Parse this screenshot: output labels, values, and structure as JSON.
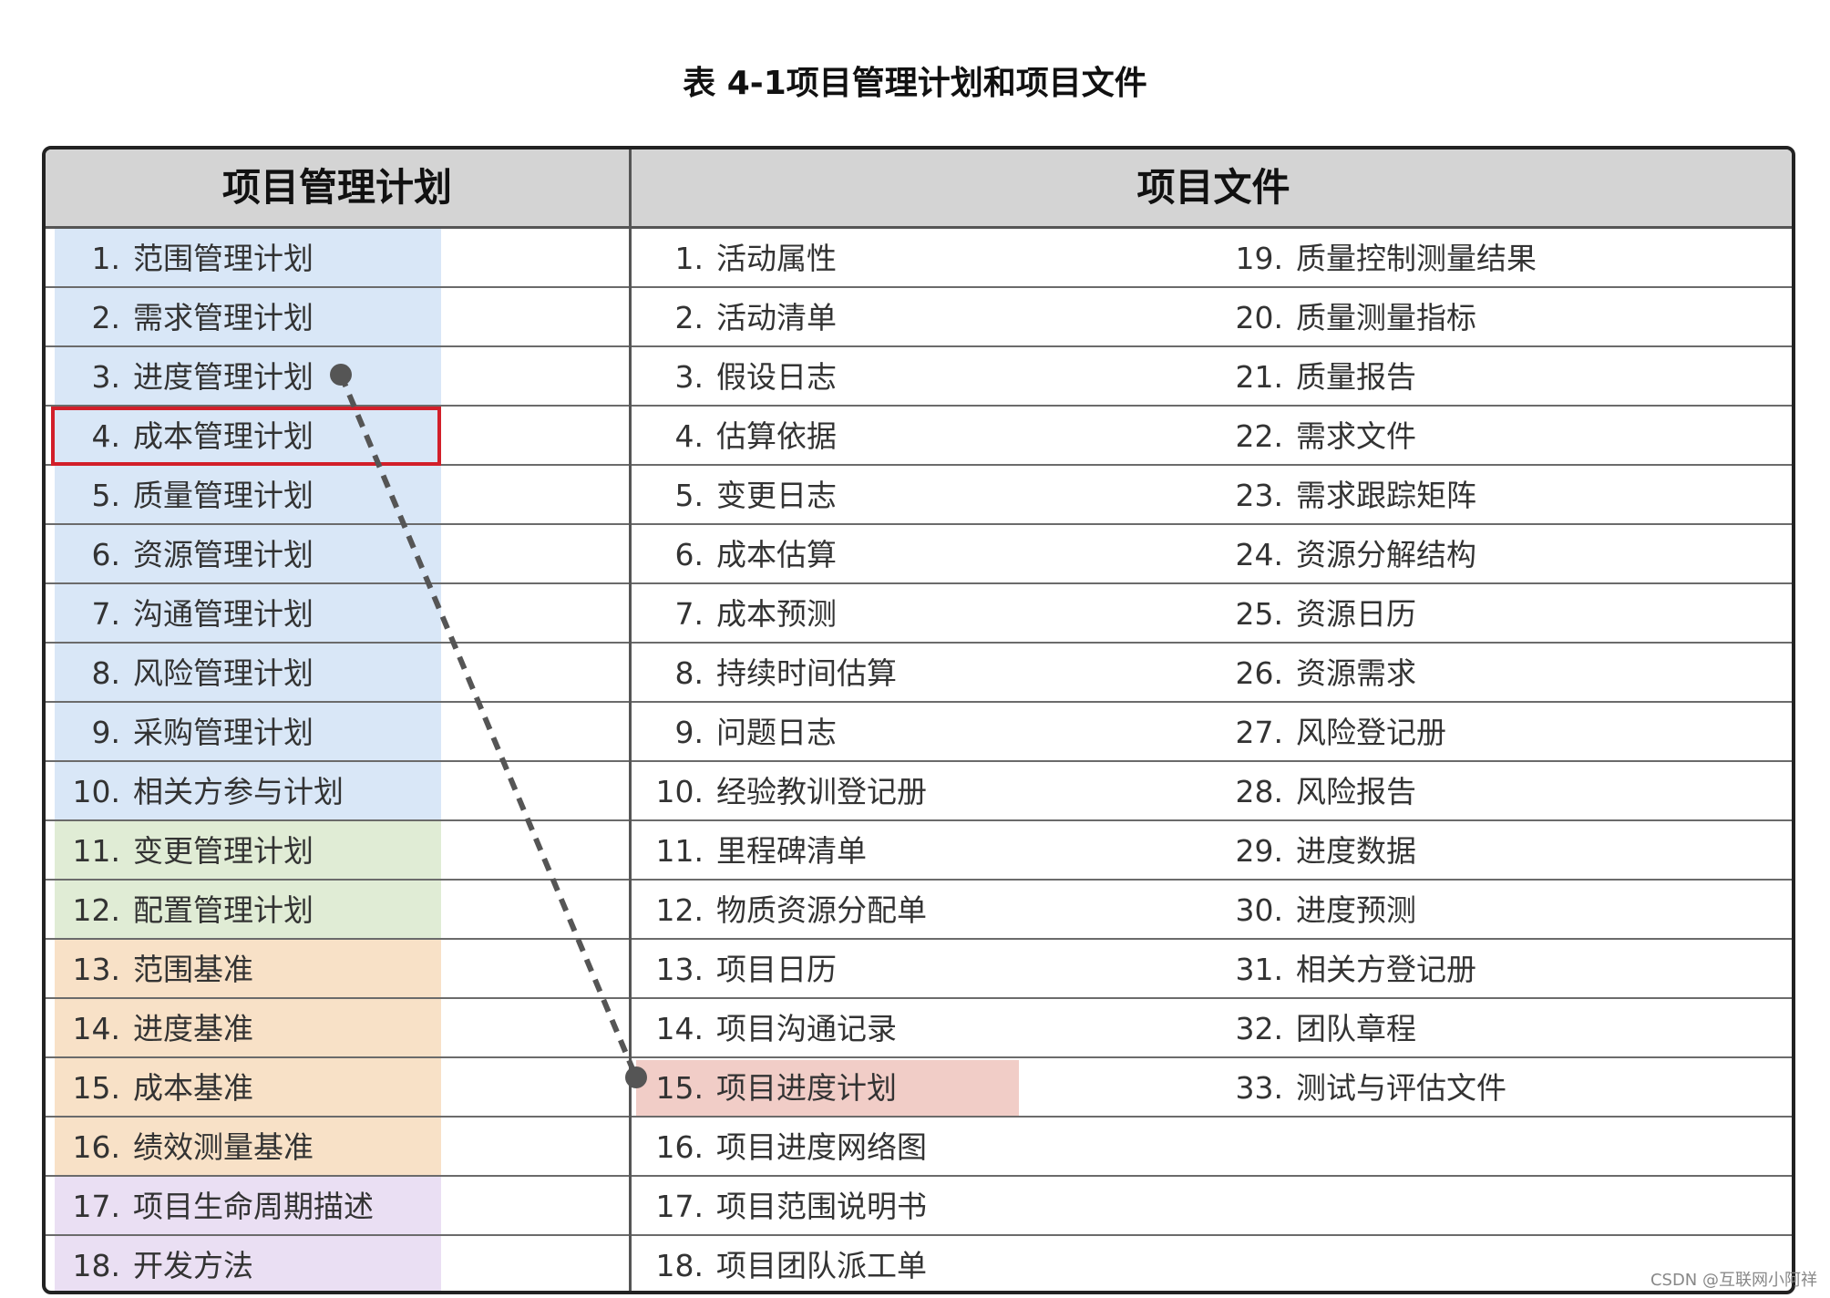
{
  "title": "表 4-1项目管理计划和项目文件",
  "headers": {
    "plan": "项目管理计划",
    "docs": "项目文件"
  },
  "colors": {
    "blue": "#d9e7f7",
    "green": "#e0ecd5",
    "orange": "#f8e1c7",
    "purple": "#eadff3",
    "red_border": "#d21f2a",
    "pink_highlight": "#f1cdc7"
  },
  "rows": [
    {
      "plan": {
        "num": "1.",
        "text": "范围管理计划"
      },
      "doc1": {
        "num": "1.",
        "text": "活动属性"
      },
      "doc2": {
        "num": "19.",
        "text": "质量控制测量结果"
      }
    },
    {
      "plan": {
        "num": "2.",
        "text": "需求管理计划"
      },
      "doc1": {
        "num": "2.",
        "text": "活动清单"
      },
      "doc2": {
        "num": "20.",
        "text": "质量测量指标"
      }
    },
    {
      "plan": {
        "num": "3.",
        "text": "进度管理计划"
      },
      "doc1": {
        "num": "3.",
        "text": "假设日志"
      },
      "doc2": {
        "num": "21.",
        "text": "质量报告"
      }
    },
    {
      "plan": {
        "num": "4.",
        "text": "成本管理计划"
      },
      "doc1": {
        "num": "4.",
        "text": "估算依据"
      },
      "doc2": {
        "num": "22.",
        "text": "需求文件"
      }
    },
    {
      "plan": {
        "num": "5.",
        "text": "质量管理计划"
      },
      "doc1": {
        "num": "5.",
        "text": "变更日志"
      },
      "doc2": {
        "num": "23.",
        "text": "需求跟踪矩阵"
      }
    },
    {
      "plan": {
        "num": "6.",
        "text": "资源管理计划"
      },
      "doc1": {
        "num": "6.",
        "text": "成本估算"
      },
      "doc2": {
        "num": "24.",
        "text": "资源分解结构"
      }
    },
    {
      "plan": {
        "num": "7.",
        "text": "沟通管理计划"
      },
      "doc1": {
        "num": "7.",
        "text": "成本预测"
      },
      "doc2": {
        "num": "25.",
        "text": "资源日历"
      }
    },
    {
      "plan": {
        "num": "8.",
        "text": "风险管理计划"
      },
      "doc1": {
        "num": "8.",
        "text": "持续时间估算"
      },
      "doc2": {
        "num": "26.",
        "text": "资源需求"
      }
    },
    {
      "plan": {
        "num": "9.",
        "text": "采购管理计划"
      },
      "doc1": {
        "num": "9.",
        "text": "问题日志"
      },
      "doc2": {
        "num": "27.",
        "text": "风险登记册"
      }
    },
    {
      "plan": {
        "num": "10.",
        "text": "相关方参与计划"
      },
      "doc1": {
        "num": "10.",
        "text": "经验教训登记册"
      },
      "doc2": {
        "num": "28.",
        "text": "风险报告"
      }
    },
    {
      "plan": {
        "num": "11.",
        "text": "变更管理计划"
      },
      "doc1": {
        "num": "11.",
        "text": "里程碑清单"
      },
      "doc2": {
        "num": "29.",
        "text": "进度数据"
      }
    },
    {
      "plan": {
        "num": "12.",
        "text": "配置管理计划"
      },
      "doc1": {
        "num": "12.",
        "text": "物质资源分配单"
      },
      "doc2": {
        "num": "30.",
        "text": "进度预测"
      }
    },
    {
      "plan": {
        "num": "13.",
        "text": "范围基准"
      },
      "doc1": {
        "num": "13.",
        "text": "项目日历"
      },
      "doc2": {
        "num": "31.",
        "text": "相关方登记册"
      }
    },
    {
      "plan": {
        "num": "14.",
        "text": "进度基准"
      },
      "doc1": {
        "num": "14.",
        "text": "项目沟通记录"
      },
      "doc2": {
        "num": "32.",
        "text": "团队章程"
      }
    },
    {
      "plan": {
        "num": "15.",
        "text": "成本基准"
      },
      "doc1": {
        "num": "15.",
        "text": "项目进度计划"
      },
      "doc2": {
        "num": "33.",
        "text": "测试与评估文件"
      }
    },
    {
      "plan": {
        "num": "16.",
        "text": "绩效测量基准"
      },
      "doc1": {
        "num": "16.",
        "text": "项目进度网络图"
      },
      "doc2": {
        "num": "",
        "text": ""
      }
    },
    {
      "plan": {
        "num": "17.",
        "text": "项目生命周期描述"
      },
      "doc1": {
        "num": "17.",
        "text": "项目范围说明书"
      },
      "doc2": {
        "num": "",
        "text": ""
      }
    },
    {
      "plan": {
        "num": "18.",
        "text": "开发方法"
      },
      "doc1": {
        "num": "18.",
        "text": "项目团队派工单"
      },
      "doc2": {
        "num": "",
        "text": ""
      }
    }
  ],
  "watermark": "CSDN @互联网小阿祥"
}
